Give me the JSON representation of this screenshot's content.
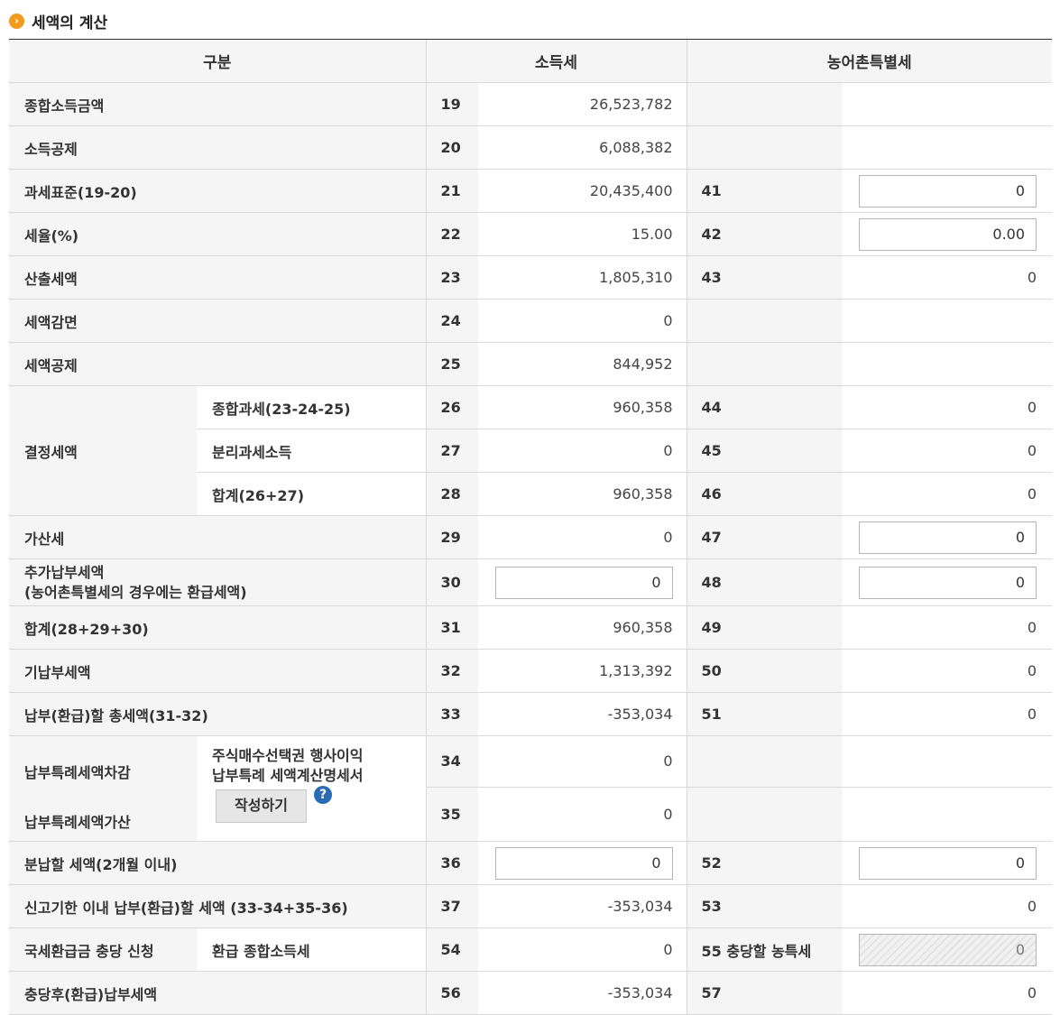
{
  "section": {
    "title": "세액의 계산"
  },
  "headers": {
    "category": "구분",
    "income_tax": "소득세",
    "rural_tax": "농어촌특별세"
  },
  "rows": {
    "r19": {
      "label": "종합소득금액",
      "no": "19",
      "value": "26,523,782"
    },
    "r20": {
      "label": "소득공제",
      "no": "20",
      "value": "6,088,382"
    },
    "r21": {
      "label": "과세표준(19-20)",
      "no": "21",
      "value": "20,435,400",
      "rno": "41",
      "rinput": "0"
    },
    "r22": {
      "label": "세율(%)",
      "no": "22",
      "value": "15.00",
      "rno": "42",
      "rinput": "0.00"
    },
    "r23": {
      "label": "산출세액",
      "no": "23",
      "value": "1,805,310",
      "rno": "43",
      "rvalue": "0"
    },
    "r24": {
      "label": "세액감면",
      "no": "24",
      "value": "0"
    },
    "r25": {
      "label": "세액공제",
      "no": "25",
      "value": "844,952"
    },
    "decided": {
      "label": "결정세액"
    },
    "r26": {
      "label": "종합과세(23-24-25)",
      "no": "26",
      "value": "960,358",
      "rno": "44",
      "rvalue": "0"
    },
    "r27": {
      "label": "분리과세소득",
      "no": "27",
      "value": "0",
      "rno": "45",
      "rvalue": "0"
    },
    "r28": {
      "label": "합계(26+27)",
      "no": "28",
      "value": "960,358",
      "rno": "46",
      "rvalue": "0"
    },
    "r29": {
      "label": "가산세",
      "no": "29",
      "value": "0",
      "rno": "47",
      "rinput": "0"
    },
    "r30": {
      "label1": "추가납부세액",
      "label2": "(농어촌특별세의 경우에는 환급세액)",
      "no": "30",
      "input": "0",
      "rno": "48",
      "rinput": "0"
    },
    "r31": {
      "label": "합계(28+29+30)",
      "no": "31",
      "value": "960,358",
      "rno": "49",
      "rvalue": "0"
    },
    "r32": {
      "label": "기납부세액",
      "no": "32",
      "value": "1,313,392",
      "rno": "50",
      "rvalue": "0"
    },
    "r33": {
      "label": "납부(환급)할 총세액(31-32)",
      "no": "33",
      "value": "-353,034",
      "rno": "51",
      "rvalue": "0"
    },
    "r34": {
      "label": "납부특례세액차감",
      "no": "34",
      "value": "0"
    },
    "r35": {
      "label": "납부특례세액가산",
      "no": "35",
      "value": "0"
    },
    "special": {
      "line1": "주식매수선택권 행사이익",
      "line2": "납부특례 세액계산명세서",
      "button": "작성하기",
      "help": "?"
    },
    "r36": {
      "label": "분납할 세액(2개월 이내)",
      "no": "36",
      "input": "0",
      "rno": "52",
      "rinput": "0"
    },
    "r37": {
      "label": "신고기한 이내 납부(환급)할 세액 (33-34+35-36)",
      "no": "37",
      "value": "-353,034",
      "rno": "53",
      "rvalue": "0"
    },
    "r54": {
      "label": "국세환급금 충당 신청",
      "sub": "환급 종합소득세",
      "no": "54",
      "value": "0",
      "rno": "55 충당할 농특세",
      "rinput": "0"
    },
    "r56": {
      "label": "충당후(환급)납부세액",
      "no": "56",
      "value": "-353,034",
      "rno": "57",
      "rvalue": "0"
    }
  }
}
